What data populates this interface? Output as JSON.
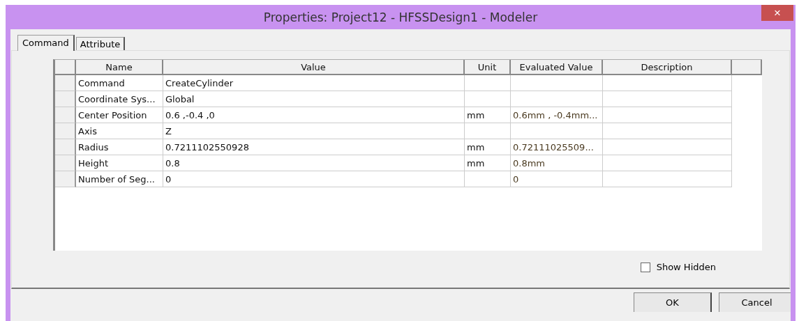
{
  "window": {
    "title": "Properties: Project12 - HFSSDesign1 - Modeler",
    "close": "×"
  },
  "tabs": [
    {
      "label": "Command",
      "selected": true
    },
    {
      "label": "Attribute",
      "selected": false
    }
  ],
  "table": {
    "columns": [
      "Name",
      "Value",
      "Unit",
      "Evaluated Value",
      "Description"
    ],
    "rows": [
      {
        "name": "Command",
        "value": "CreateCylinder",
        "unit": "",
        "evaluated": ""
      },
      {
        "name": "Coordinate Sys...",
        "value": "Global",
        "unit": "",
        "evaluated": ""
      },
      {
        "name": "Center Position",
        "value": "0.6 ,-0.4 ,0",
        "unit": "mm",
        "evaluated": "0.6mm , -0.4mm..."
      },
      {
        "name": "Axis",
        "value": "Z",
        "unit": "",
        "evaluated": ""
      },
      {
        "name": "Radius",
        "value": "0.7211102550928",
        "unit": "mm",
        "evaluated": "0.72111025509..."
      },
      {
        "name": "Height",
        "value": "0.8",
        "unit": "mm",
        "evaluated": "0.8mm"
      },
      {
        "name": "Number of Seg...",
        "value": "0",
        "unit": "",
        "evaluated": "0"
      }
    ]
  },
  "show_hidden": {
    "label": "Show Hidden",
    "checked": false
  },
  "buttons": [
    "OK",
    "Cancel"
  ]
}
